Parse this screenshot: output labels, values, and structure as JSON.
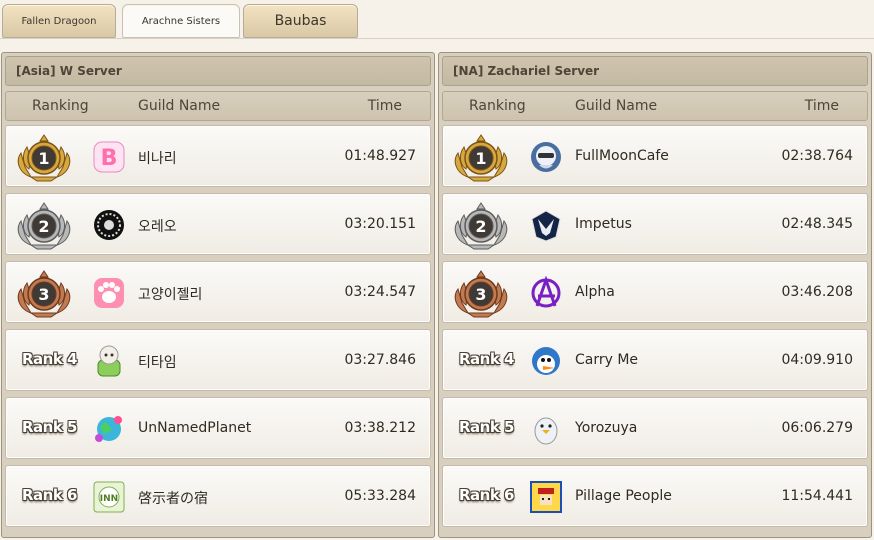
{
  "tabs": [
    {
      "label": "Fallen Dragoon",
      "active": false
    },
    {
      "label": "Arachne Sisters",
      "active": true
    },
    {
      "label": "Baubas",
      "active": false
    }
  ],
  "columns": {
    "ranking": "Ranking",
    "guild": "Guild Name",
    "time": "Time"
  },
  "panels": [
    {
      "server": "[Asia] W Server",
      "rows": [
        {
          "rank": "1",
          "guild": "비나리",
          "time": "01:48.927",
          "emblem": "letter-b-emblem-icon"
        },
        {
          "rank": "2",
          "guild": "오레오",
          "time": "03:20.151",
          "emblem": "lace-circle-emblem-icon"
        },
        {
          "rank": "3",
          "guild": "고양이젤리",
          "time": "03:24.547",
          "emblem": "paw-emblem-icon"
        },
        {
          "rank": "Rank 4",
          "guild": "티타임",
          "time": "03:27.846",
          "emblem": "sheep-cup-emblem-icon"
        },
        {
          "rank": "Rank 5",
          "guild": "UnNamedPlanet",
          "time": "03:38.212",
          "emblem": "planet-emblem-icon"
        },
        {
          "rank": "Rank 6",
          "guild": "啓示者の宿",
          "time": "05:33.284",
          "emblem": "inn-emblem-icon"
        }
      ]
    },
    {
      "server": "[NA] Zachariel Server",
      "rows": [
        {
          "rank": "1",
          "guild": "FullMoonCafe",
          "time": "02:38.764",
          "emblem": "cafe-emblem-icon"
        },
        {
          "rank": "2",
          "guild": "Impetus",
          "time": "02:48.345",
          "emblem": "phoenix-emblem-icon"
        },
        {
          "rank": "3",
          "guild": "Alpha",
          "time": "03:46.208",
          "emblem": "anarchy-emblem-icon"
        },
        {
          "rank": "Rank 4",
          "guild": "Carry Me",
          "time": "04:09.910",
          "emblem": "bird-emblem-icon"
        },
        {
          "rank": "Rank 5",
          "guild": "Yorozuya",
          "time": "06:06.279",
          "emblem": "penguin-emblem-icon"
        },
        {
          "rank": "Rank 6",
          "guild": "Pillage People",
          "time": "11:54.441",
          "emblem": "pixel-face-emblem-icon"
        }
      ]
    }
  ],
  "colors": {
    "gold": "#c9972f",
    "silver": "#9a9a9a",
    "bronze": "#b3673e",
    "badge_dark": "#3a3a3a"
  }
}
